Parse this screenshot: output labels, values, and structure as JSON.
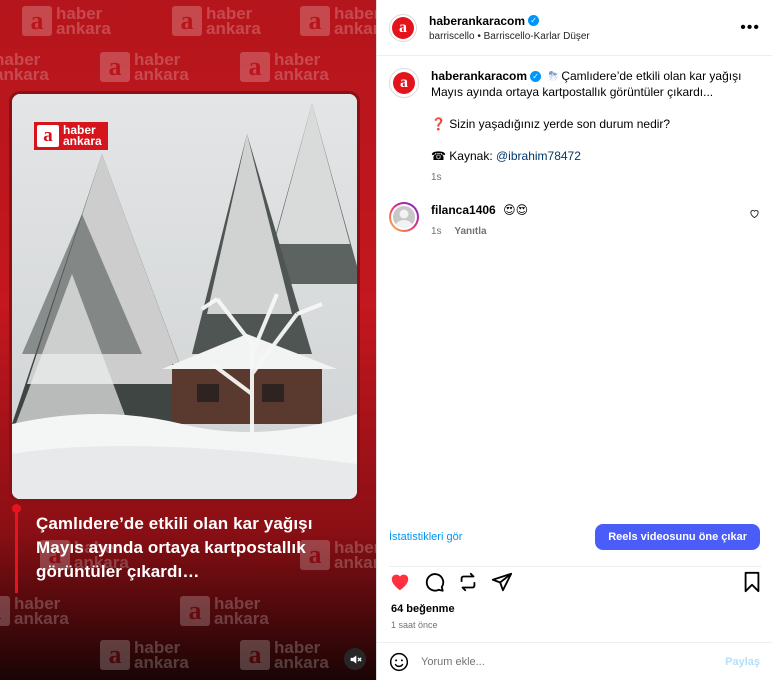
{
  "media": {
    "watermark_line1": "haber",
    "watermark_line2": "ankara",
    "logo_letter": "a",
    "caption": "Çamlıdere’de etkili olan kar yağışı Mayıs ayında ortaya kartpostallık görüntüler çıkardı…"
  },
  "header": {
    "username": "haberankaracom",
    "audio": "barriscello • Barriscello-Karlar Düşer",
    "more": "•••",
    "avatar_letter": "a"
  },
  "caption_comment": {
    "username": "haberankaracom",
    "emoji": "⛈",
    "text": "Çamlıdere’de etkili olan kar yağışı Mayıs ayında ortaya kartpostallık görüntüler çıkardı...",
    "question_icon": "❓",
    "question": "Sizin yaşadığınız yerde son durum nedir?",
    "source_icon": "☎",
    "source_label": "Kaynak:",
    "source_handle": "@ibrahim78472",
    "time": "1s"
  },
  "comment": {
    "username": "filanca1406",
    "text": "😍😍",
    "time": "1s",
    "reply": "Yanıtla"
  },
  "insights": {
    "link": "İstatistikleri gör",
    "boost": "Reels videosunu öne çıkar"
  },
  "stats": {
    "likes": "64 beğenme",
    "ago": "1 saat önce"
  },
  "add_comment": {
    "placeholder": "Yorum ekle...",
    "post": "Paylaş"
  },
  "colors": {
    "brand_red": "#c4171f",
    "link_blue": "#0095f6",
    "boost_button": "#4a5df9",
    "like_red": "#ff3040"
  }
}
